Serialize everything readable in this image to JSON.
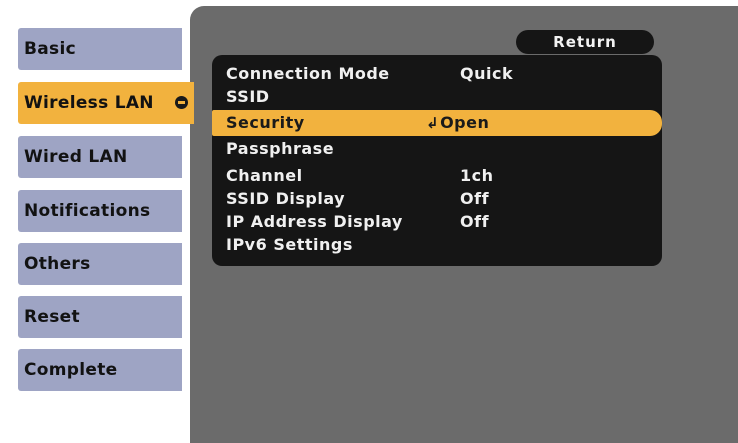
{
  "sidebar": {
    "tabs": [
      {
        "label": "Basic"
      },
      {
        "label": "Wireless LAN",
        "active": true
      },
      {
        "label": "Wired LAN"
      },
      {
        "label": "Notifications"
      },
      {
        "label": "Others"
      },
      {
        "label": "Reset"
      },
      {
        "label": "Complete"
      }
    ]
  },
  "panel": {
    "return_label": "Return",
    "rows": [
      {
        "label": "Connection Mode",
        "value": "Quick"
      },
      {
        "label": "SSID",
        "value": ""
      },
      {
        "label": "Security",
        "value": "Open",
        "selected": true,
        "value_icon": "enter-icon"
      },
      {
        "label": "Passphrase",
        "value": ""
      },
      {
        "label": "Channel",
        "value": "1ch"
      },
      {
        "label": "SSID Display",
        "value": "Off"
      },
      {
        "label": "IP Address Display",
        "value": "Off"
      },
      {
        "label": "IPv6 Settings",
        "value": ""
      }
    ]
  },
  "colors": {
    "accent": "#f2b23e",
    "tab": "#9ea4c4",
    "panel_bg": "#6b6b6b",
    "menu_bg": "#151515"
  }
}
